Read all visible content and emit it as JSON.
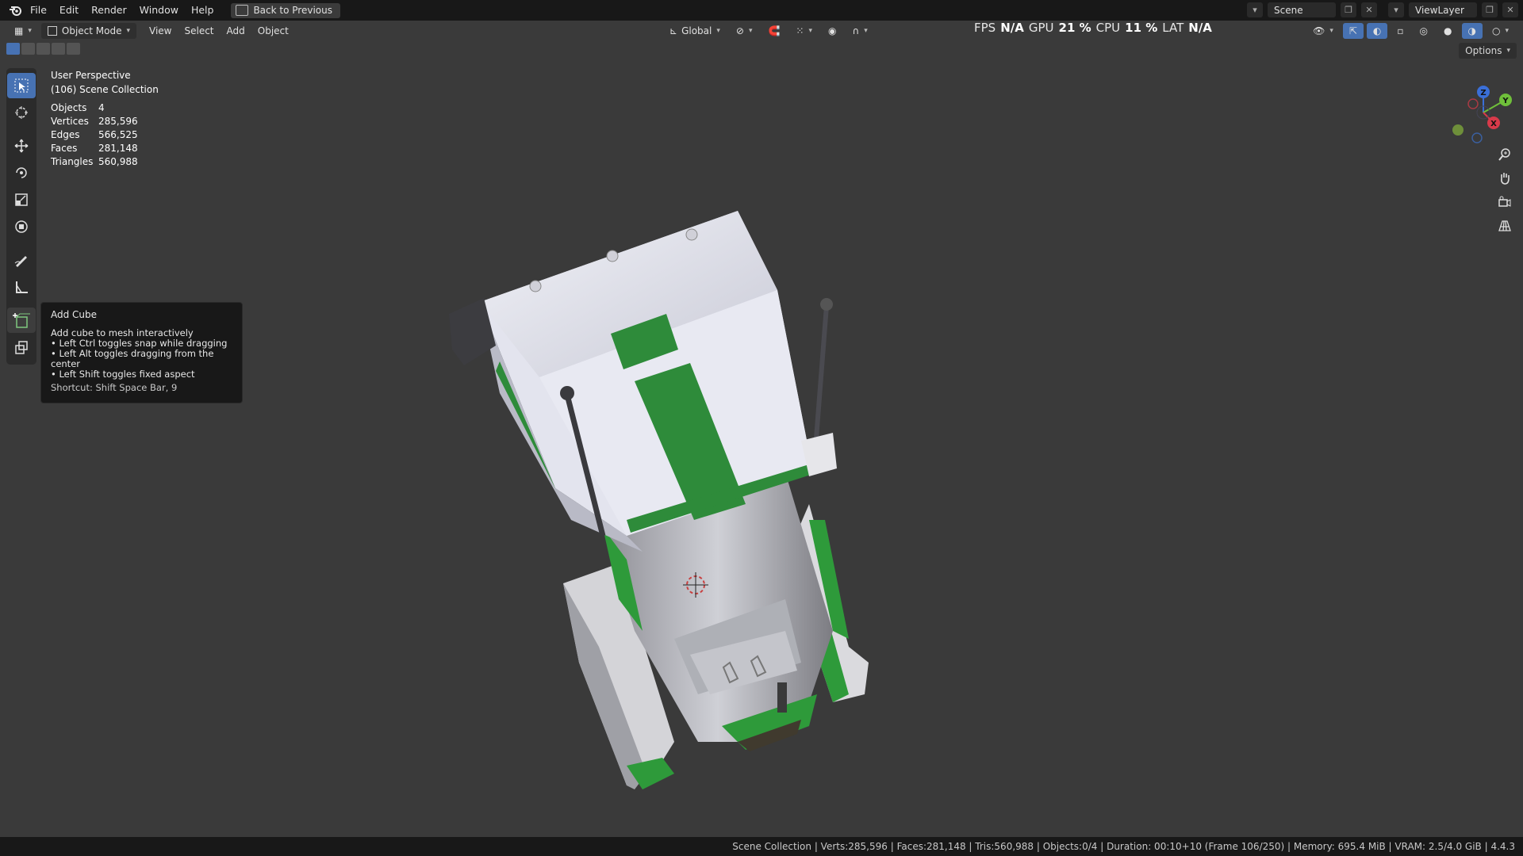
{
  "menu": {
    "file": "File",
    "edit": "Edit",
    "render": "Render",
    "window": "Window",
    "help": "Help",
    "back": "Back to Previous"
  },
  "top_right": {
    "scene": "Scene",
    "view_layer": "ViewLayer"
  },
  "header": {
    "mode": "Object Mode",
    "view": "View",
    "select": "Select",
    "add": "Add",
    "object": "Object",
    "orientation": "Global",
    "options": "Options"
  },
  "perf": {
    "fps_label": "FPS",
    "fps": "N/A",
    "gpu_label": "GPU",
    "gpu": "21 %",
    "cpu_label": "CPU",
    "cpu": "11 %",
    "lat_label": "LAT",
    "lat": "N/A"
  },
  "viewport_info": {
    "perspective": "User Perspective",
    "collection": "(106) Scene Collection",
    "stats": [
      {
        "label": "Objects",
        "value": "4"
      },
      {
        "label": "Vertices",
        "value": "285,596"
      },
      {
        "label": "Edges",
        "value": "566,525"
      },
      {
        "label": "Faces",
        "value": "281,148"
      },
      {
        "label": "Triangles",
        "value": "560,988"
      }
    ]
  },
  "tooltip": {
    "title": "Add Cube",
    "desc": "Add cube to mesh interactively",
    "lines": [
      "• Left Ctrl toggles snap while dragging",
      "• Left Alt toggles dragging from the center",
      "• Left Shift toggles fixed aspect"
    ],
    "shortcut": "Shortcut: Shift Space Bar, 9"
  },
  "gizmo": {
    "x": "X",
    "y": "Y",
    "z": "Z"
  },
  "statusbar": {
    "text": "Scene Collection | Verts:285,596 | Faces:281,148 | Tris:560,988 | Objects:0/4 | Duration: 00:10+10 (Frame 106/250) | Memory: 695.4 MiB | VRAM: 2.5/4.0 GiB | 4.4.3"
  },
  "colors": {
    "accent": "#4772b3",
    "model_green": "#2e8b3a",
    "viewport": "#3a3a3a"
  }
}
